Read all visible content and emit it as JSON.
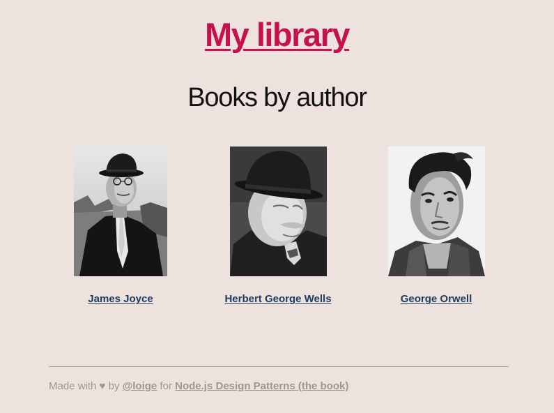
{
  "site_title": "My library",
  "heading": "Books by author",
  "authors": [
    {
      "name": "James Joyce",
      "portrait_icon": "portrait-photo-icon"
    },
    {
      "name": "Herbert George Wells",
      "portrait_icon": "portrait-photo-icon"
    },
    {
      "name": "George Orwell",
      "portrait_icon": "portrait-photo-icon"
    }
  ],
  "footer": {
    "made_with": "Made with",
    "heart": "♥",
    "by": "by",
    "author_link": "@loige",
    "for": "for",
    "book_link": "Node.js Design Patterns (the book)"
  },
  "colors": {
    "background": "#ede2dd",
    "title": "#c4124b",
    "author_link": "#1d3b5f",
    "footer_text": "#9e9692"
  }
}
